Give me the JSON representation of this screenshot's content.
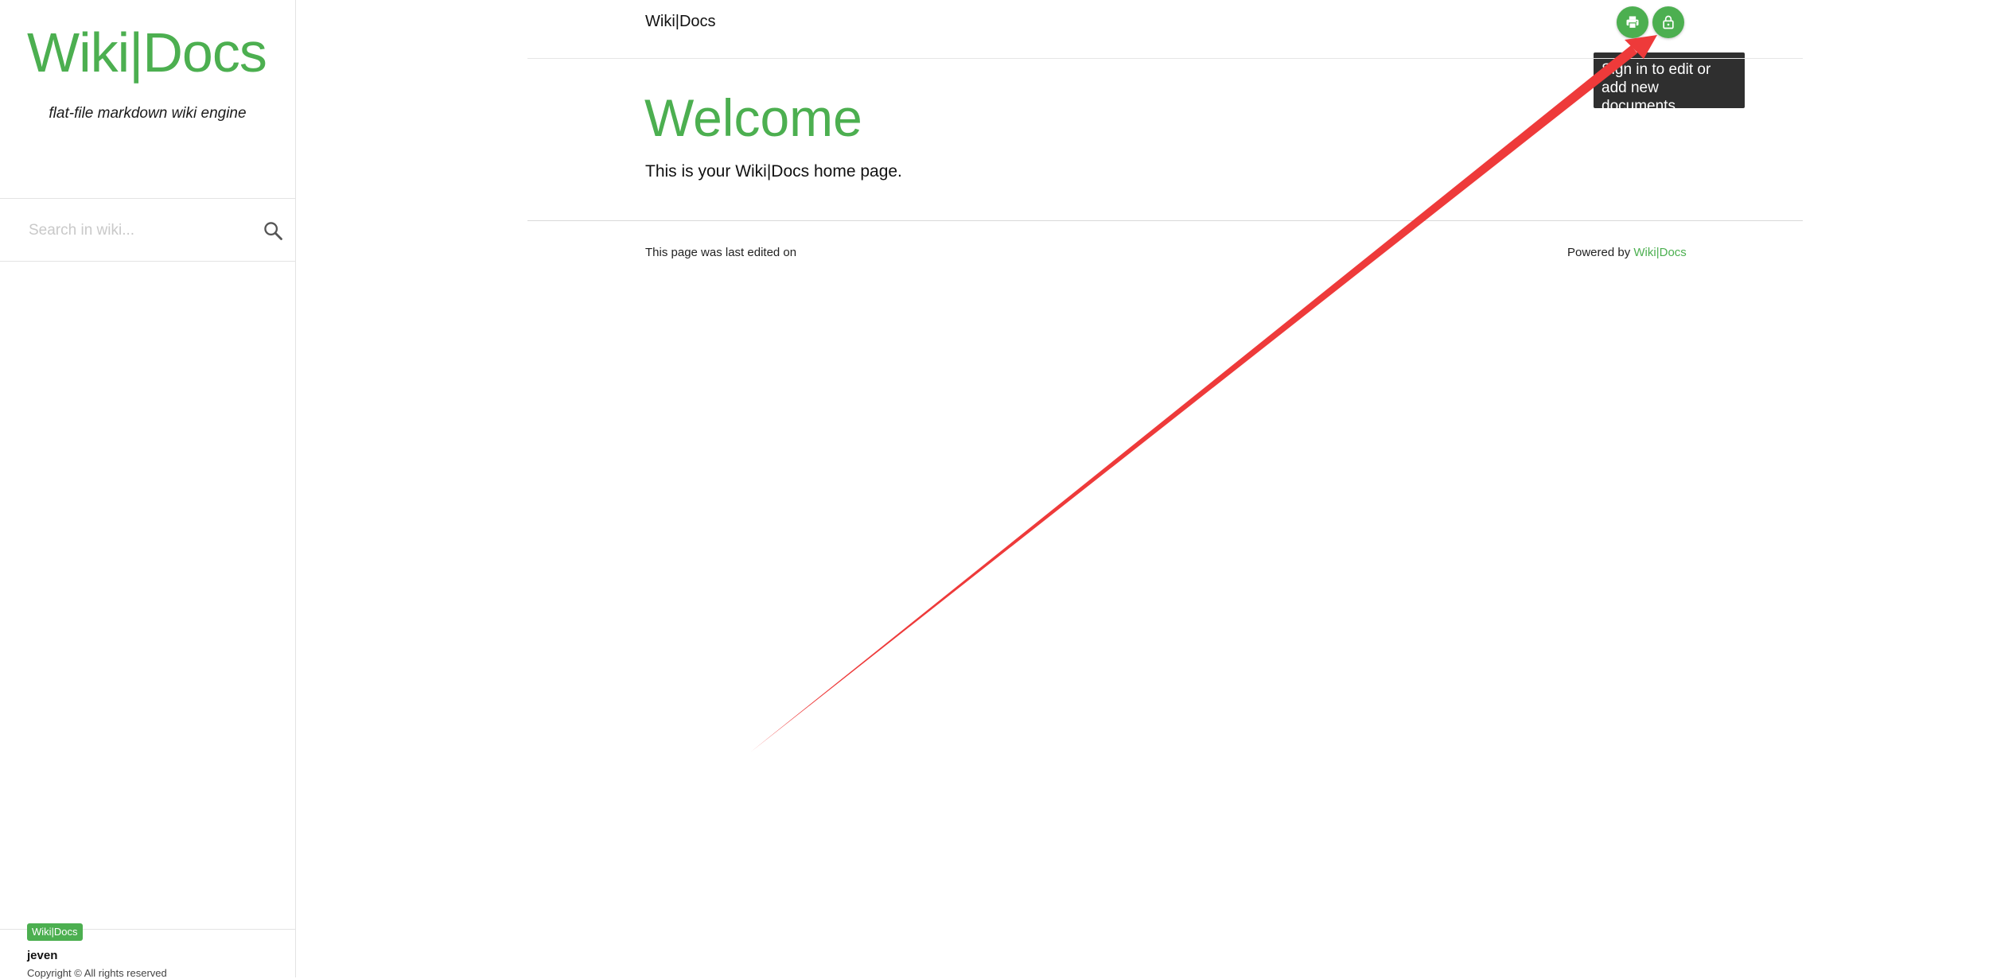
{
  "sidebar": {
    "brand": "Wiki|Docs",
    "tagline": "flat-file markdown wiki engine",
    "search": {
      "placeholder": "Search in wiki...",
      "value": "",
      "icon": "search-icon"
    },
    "footer": {
      "badge": "Wiki|Docs",
      "author": "jeven",
      "copyright": "Copyright © All rights reserved"
    }
  },
  "header": {
    "title": "Wiki|Docs",
    "buttons": [
      {
        "name": "print",
        "icon": "printer-icon"
      },
      {
        "name": "sign-in",
        "icon": "lock-icon"
      }
    ],
    "tooltip": {
      "line1": "Sign in to edit or",
      "line2": "add new documents"
    }
  },
  "page": {
    "title": "Welcome",
    "body": "This is your Wiki|Docs home page."
  },
  "footer": {
    "last_edited": "This page was last edited on",
    "powered_prefix": "Powered by",
    "powered_link": "Wiki|Docs"
  },
  "colors": {
    "accent": "#4caf50",
    "tooltip_bg": "#2f2f2f",
    "annotation_arrow": "#ee3a3a"
  }
}
